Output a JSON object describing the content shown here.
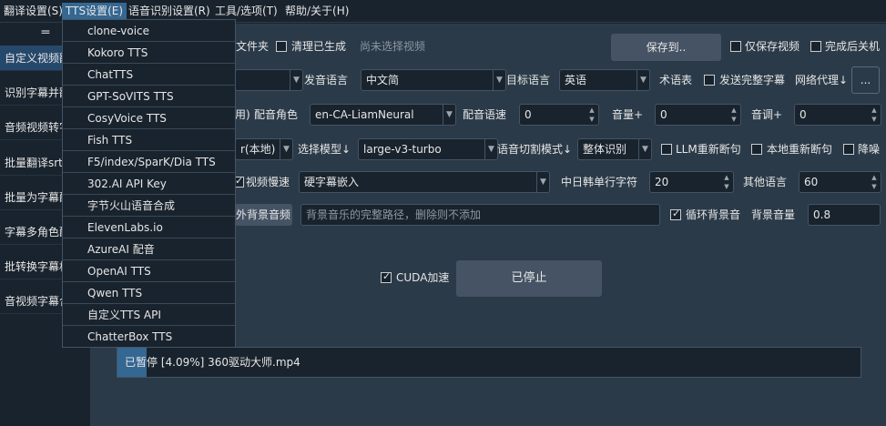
{
  "menubar": {
    "items": [
      "翻译设置(S)",
      "TTS设置(E)",
      "语音识别设置(R)",
      "工具/选项(T)",
      "帮助/关于(H)"
    ]
  },
  "sidebar": {
    "handle": "═",
    "items": [
      "自定义视频翻译",
      "识别字幕并翻译",
      "音频视频转字幕",
      "批量翻译srt字幕",
      "批量为字幕配音",
      "字幕多角色配音",
      "批转换字幕格式",
      "音视频字幕合并"
    ]
  },
  "tts_menu": {
    "items": [
      "clone-voice",
      "Kokoro TTS",
      "ChatTTS",
      "GPT-SoVITS TTS",
      "CosyVoice TTS",
      "Fish TTS",
      "F5/index/SparK/Dia TTS",
      "302.AI API Key",
      "字节火山语音合成",
      "ElevenLabs.io",
      "AzureAI 配音",
      "OpenAI TTS",
      "Qwen TTS",
      "自定义TTS API",
      "ChatterBox TTS"
    ]
  },
  "row1": {
    "folder_label": "文件夹",
    "clear_label": "清理已生成",
    "no_video": "尚未选择视频",
    "save_to": "保存到..",
    "only_video": "仅保存视频",
    "shutdown": "完成后关机"
  },
  "row2": {
    "source_lang_label": "发音语言",
    "source_lang": "中文简",
    "target_lang_label": "目标语言",
    "target_lang": "英语",
    "glossary": "术语表",
    "send_full": "发送完整字幕",
    "proxy": "网络代理↓",
    "more": "..."
  },
  "row3": {
    "tts_fragment": "用)",
    "role_label": "配音角色",
    "role": "en-CA-LiamNeural",
    "speed_label": "配音语速",
    "speed": "0",
    "volume_label": "音量+",
    "volume": "0",
    "pitch_label": "音调+",
    "pitch": "0"
  },
  "row4": {
    "mode_fragment": "r(本地)",
    "model_label": "选择模型↓",
    "model": "large-v3-turbo",
    "split_label": "语音切割模式↓",
    "split": "整体识别",
    "llm_resplit": "LLM重新断句",
    "local_resplit": "本地重新断句",
    "denoise": "降噪"
  },
  "row5": {
    "slow_video": "视频慢速",
    "subtitle_mode": "硬字幕嵌入",
    "cjk_chars_label": "中日韩单行字符",
    "cjk_chars": "20",
    "other_lang_label": "其他语言",
    "other_lang": "60"
  },
  "row6": {
    "bgm_button": "外背景音频",
    "bgm_placeholder": "背景音乐的完整路径，删除则不添加",
    "loop_bgm": "循环背景音",
    "bgm_volume_label": "背景音量",
    "bgm_volume": "0.8"
  },
  "actions": {
    "cuda": "CUDA加速",
    "stop": "已停止"
  },
  "progress": {
    "text": "已暂停 [4.09%] 360驱动大师.mp4",
    "percent": 4.09
  },
  "colors": {
    "accent": "#346792",
    "background": "#19232d",
    "panel": "#2b3a48"
  }
}
